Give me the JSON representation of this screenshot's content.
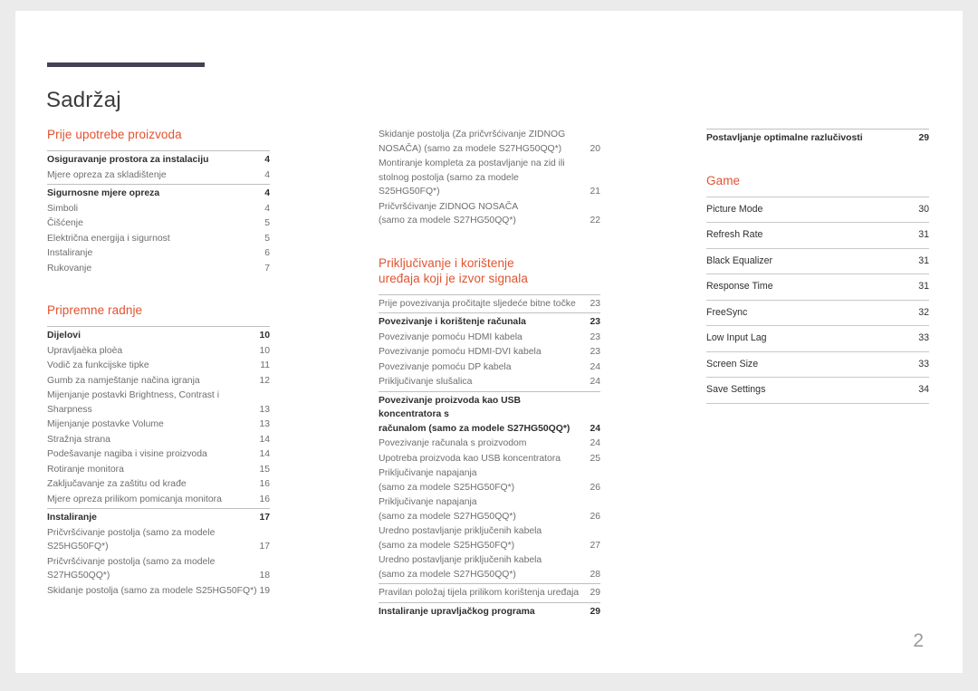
{
  "document": {
    "title": "Sadržaj",
    "folio": "2",
    "accent_color": "#e2522f",
    "rule_color": "#454154",
    "page_background": "#ffffff",
    "canvas_background": "#ebebeb"
  },
  "columns": [
    {
      "name": "column-1",
      "groups": [
        {
          "heading": "Prije upotrebe proizvoda",
          "entries": [
            {
              "label": "Osiguravanje prostora za instalaciju",
              "page": "4",
              "head": true,
              "divider": true
            },
            {
              "label": "Mjere opreza za skladištenje",
              "page": "4",
              "head": false,
              "divider": false
            },
            {
              "label": "Sigurnosne mjere opreza",
              "page": "4",
              "head": true,
              "divider": true
            },
            {
              "label": "Simboli",
              "page": "4",
              "head": false,
              "divider": false
            },
            {
              "label": "Čišćenje",
              "page": "5",
              "head": false,
              "divider": false
            },
            {
              "label": "Električna energija i sigurnost",
              "page": "5",
              "head": false,
              "divider": false
            },
            {
              "label": "Instaliranje",
              "page": "6",
              "head": false,
              "divider": false
            },
            {
              "label": "Rukovanje",
              "page": "7",
              "head": false,
              "divider": false
            }
          ]
        },
        {
          "heading": "Pripremne radnje",
          "entries": [
            {
              "label": "Dijelovi",
              "page": "10",
              "head": true,
              "divider": true
            },
            {
              "label": "Upravljaèka ploèa",
              "page": "10",
              "head": false,
              "divider": false
            },
            {
              "label": "Vodič za funkcijske tipke",
              "page": "11",
              "head": false,
              "divider": false
            },
            {
              "label": "Gumb za namještanje načina igranja",
              "page": "12",
              "head": false,
              "divider": false
            },
            {
              "label": "Mijenjanje postavki Brightness, Contrast i\nSharpness",
              "page": "13",
              "head": false,
              "divider": false
            },
            {
              "label": "Mijenjanje postavke Volume",
              "page": "13",
              "head": false,
              "divider": false
            },
            {
              "label": "Stražnja strana",
              "page": "14",
              "head": false,
              "divider": false
            },
            {
              "label": "Podešavanje nagiba i visine proizvoda",
              "page": "14",
              "head": false,
              "divider": false
            },
            {
              "label": "Rotiranje monitora",
              "page": "15",
              "head": false,
              "divider": false
            },
            {
              "label": "Zaključavanje za zaštitu od krađe",
              "page": "16",
              "head": false,
              "divider": false
            },
            {
              "label": "Mjere opreza prilikom pomicanja monitora",
              "page": "16",
              "head": false,
              "divider": false
            },
            {
              "label": "Instaliranje",
              "page": "17",
              "head": true,
              "divider": true
            },
            {
              "label": "Pričvršćivanje postolja (samo za modele\nS25HG50FQ*)",
              "page": "17",
              "head": false,
              "divider": false
            },
            {
              "label": "Pričvršćivanje postolja (samo za modele\nS27HG50QQ*)",
              "page": "18",
              "head": false,
              "divider": false
            },
            {
              "label": "Skidanje postolja (samo za modele S25HG50FQ*)",
              "page": "19",
              "head": false,
              "divider": false,
              "nogap": true
            }
          ]
        }
      ]
    },
    {
      "name": "column-2",
      "groups": [
        {
          "heading": "",
          "entries": [
            {
              "label": "Skidanje postolja (Za pričvršćivanje ZIDNOG\nNOSAČA) (samo za modele S27HG50QQ*)",
              "page": "20",
              "head": false,
              "divider": false
            },
            {
              "label": "Montiranje kompleta za postavljanje na zid ili\nstolnog postolja (samo za modele S25HG50FQ*)",
              "page": "21",
              "head": false,
              "divider": false
            },
            {
              "label": "Pričvršćivanje ZIDNOG NOSAČA\n(samo za modele S27HG50QQ*)",
              "page": "22",
              "head": false,
              "divider": false
            }
          ]
        },
        {
          "heading": "Priključivanje i korištenje\nuređaja koji je izvor signala",
          "entries": [
            {
              "label": "Prije povezivanja pročitajte sljedeće bitne točke",
              "page": "23",
              "head": false,
              "divider": true
            },
            {
              "label": "Povezivanje i korištenje računala",
              "page": "23",
              "head": true,
              "divider": true
            },
            {
              "label": "Povezivanje pomoću HDMI kabela",
              "page": "23",
              "head": false,
              "divider": false
            },
            {
              "label": "Povezivanje pomoću HDMI-DVI kabela",
              "page": "23",
              "head": false,
              "divider": false
            },
            {
              "label": "Povezivanje pomoću DP kabela",
              "page": "24",
              "head": false,
              "divider": false
            },
            {
              "label": "Priključivanje slušalica",
              "page": "24",
              "head": false,
              "divider": false
            },
            {
              "label": "Povezivanje proizvoda kao USB koncentratora s\nračunalom (samo za modele S27HG50QQ*)",
              "page": "24",
              "head": true,
              "divider": true
            },
            {
              "label": "Povezivanje računala s proizvodom",
              "page": "24",
              "head": false,
              "divider": false
            },
            {
              "label": "Upotreba proizvoda kao USB koncentratora",
              "page": "25",
              "head": false,
              "divider": false
            },
            {
              "label": "Priključivanje napajanja\n(samo za modele S25HG50FQ*)",
              "page": "26",
              "head": false,
              "divider": false
            },
            {
              "label": "Priključivanje napajanja\n(samo za modele S27HG50QQ*)",
              "page": "26",
              "head": false,
              "divider": false
            },
            {
              "label": "Uredno postavljanje priključenih kabela\n(samo za modele S25HG50FQ*)",
              "page": "27",
              "head": false,
              "divider": false
            },
            {
              "label": "Uredno postavljanje priključenih kabela\n(samo za modele S27HG50QQ*)",
              "page": "28",
              "head": false,
              "divider": false
            },
            {
              "label": "Pravilan položaj tijela prilikom korištenja uređaja",
              "page": "29",
              "head": false,
              "divider": true
            },
            {
              "label": "Instaliranje upravljačkog programa",
              "page": "29",
              "head": true,
              "divider": true
            }
          ]
        }
      ]
    },
    {
      "name": "column-3",
      "groups": [
        {
          "heading": "",
          "entries": [
            {
              "label": "Postavljanje optimalne razlučivosti",
              "page": "29",
              "head": true,
              "divider": true
            }
          ]
        },
        {
          "heading": "Game",
          "gamelist": true,
          "entries": [
            {
              "label": "Picture Mode",
              "page": "30"
            },
            {
              "label": "Refresh Rate",
              "page": "31"
            },
            {
              "label": "Black Equalizer",
              "page": "31"
            },
            {
              "label": "Response Time",
              "page": "31"
            },
            {
              "label": "FreeSync",
              "page": "32"
            },
            {
              "label": "Low Input Lag",
              "page": "33"
            },
            {
              "label": "Screen Size",
              "page": "33"
            },
            {
              "label": "Save Settings",
              "page": "34"
            }
          ]
        }
      ]
    }
  ]
}
